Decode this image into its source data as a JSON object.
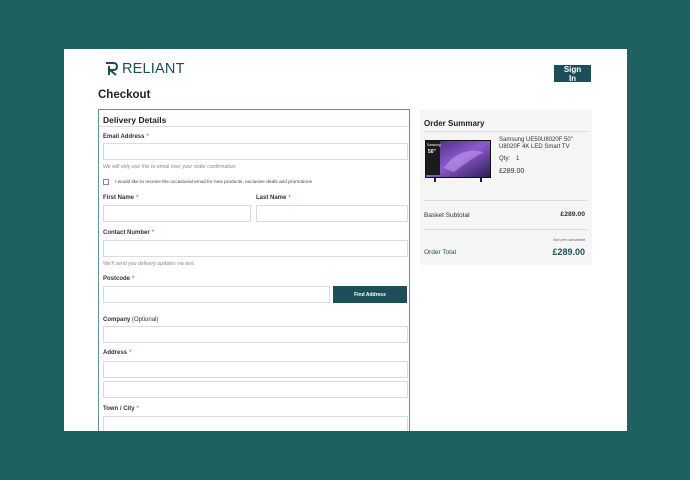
{
  "header": {
    "brand": "RELIANT",
    "sign_in": "Sign In"
  },
  "page": {
    "title": "Checkout"
  },
  "delivery": {
    "title": "Delivery Details",
    "email_label": "Email Address",
    "email_help": "We will only use this to email over your order confirmation.",
    "marketing_checkbox": "I would like to receive the occasional email for new products, exclusive deals and promotions",
    "first_name_label": "First Name",
    "last_name_label": "Last Name",
    "contact_label": "Contact Number",
    "contact_help": "We'll send you delivery updates via text.",
    "postcode_label": "Postcode",
    "find_address": "Find Address",
    "company_label": "Company",
    "company_optional": "(Optional)",
    "address_label": "Address",
    "town_label": "Town / City",
    "required_mark": "*"
  },
  "summary": {
    "title": "Order Summary",
    "product_name": "Samsung UE50U8020F 50\" U8020F 4K LED Smart TV",
    "qty_label": "Qty:",
    "qty_value": "1",
    "product_price": "£289.00",
    "thumb_badge_top": "Samsung",
    "thumb_badge_size": "50\"",
    "basket_subtotal_label": "Basket Subtotal",
    "basket_subtotal_value": "£289.00",
    "not_calculated": "Not yet calculated",
    "order_total_label": "Order Total",
    "order_total_value": "£289.00"
  },
  "colors": {
    "background": "#1d6161",
    "accent": "#1d4f58"
  }
}
